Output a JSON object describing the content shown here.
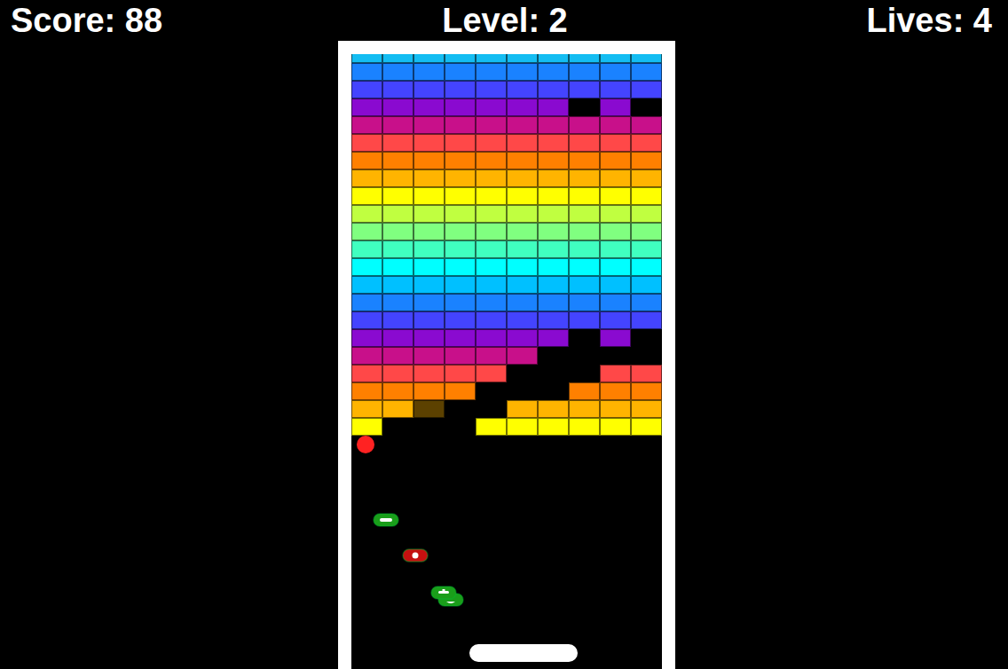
{
  "hud": {
    "score": "Score: 88",
    "level": "Level: 2",
    "lives": "Lives: 4"
  },
  "rows": [
    {
      "color": "#14bdf2",
      "present": [
        true,
        true,
        true,
        true,
        true,
        true,
        true,
        true,
        true,
        true
      ],
      "damaged": [
        false,
        false,
        false,
        false,
        false,
        false,
        false,
        false,
        false,
        false
      ]
    },
    {
      "color": "#1a82ff",
      "present": [
        true,
        true,
        true,
        true,
        true,
        true,
        true,
        true,
        true,
        true
      ],
      "damaged": [
        false,
        false,
        false,
        false,
        false,
        false,
        false,
        false,
        false,
        false
      ]
    },
    {
      "color": "#4444ff",
      "present": [
        true,
        true,
        true,
        true,
        true,
        true,
        true,
        true,
        true,
        true
      ],
      "damaged": [
        false,
        false,
        false,
        false,
        false,
        false,
        false,
        false,
        false,
        false
      ]
    },
    {
      "color": "#8a0ad0",
      "present": [
        true,
        true,
        true,
        true,
        true,
        true,
        true,
        false,
        true,
        false
      ],
      "damaged": [
        false,
        false,
        false,
        false,
        false,
        false,
        false,
        false,
        false,
        false
      ]
    },
    {
      "color": "#c8108a",
      "present": [
        true,
        true,
        true,
        true,
        true,
        true,
        true,
        true,
        true,
        true
      ],
      "damaged": [
        false,
        false,
        false,
        false,
        false,
        false,
        false,
        false,
        false,
        false
      ]
    },
    {
      "color": "#ff4848",
      "present": [
        true,
        true,
        true,
        true,
        true,
        true,
        true,
        true,
        true,
        true
      ],
      "damaged": [
        false,
        false,
        false,
        false,
        false,
        false,
        false,
        false,
        false,
        false
      ]
    },
    {
      "color": "#ff8000",
      "present": [
        true,
        true,
        true,
        true,
        true,
        true,
        true,
        true,
        true,
        true
      ],
      "damaged": [
        false,
        false,
        false,
        false,
        false,
        false,
        false,
        false,
        false,
        false
      ]
    },
    {
      "color": "#ffb400",
      "present": [
        true,
        true,
        true,
        true,
        true,
        true,
        true,
        true,
        true,
        true
      ],
      "damaged": [
        false,
        false,
        false,
        false,
        false,
        false,
        false,
        false,
        false,
        false
      ]
    },
    {
      "color": "#ffff00",
      "present": [
        true,
        true,
        true,
        true,
        true,
        true,
        true,
        true,
        true,
        true
      ],
      "damaged": [
        false,
        false,
        false,
        false,
        false,
        false,
        false,
        false,
        false,
        false
      ]
    },
    {
      "color": "#c0ff40",
      "present": [
        true,
        true,
        true,
        true,
        true,
        true,
        true,
        true,
        true,
        true
      ],
      "damaged": [
        false,
        false,
        false,
        false,
        false,
        false,
        false,
        false,
        false,
        false
      ]
    },
    {
      "color": "#80ff80",
      "present": [
        true,
        true,
        true,
        true,
        true,
        true,
        true,
        true,
        true,
        true
      ],
      "damaged": [
        false,
        false,
        false,
        false,
        false,
        false,
        false,
        false,
        false,
        false
      ]
    },
    {
      "color": "#40ffc0",
      "present": [
        true,
        true,
        true,
        true,
        true,
        true,
        true,
        true,
        true,
        true
      ],
      "damaged": [
        false,
        false,
        false,
        false,
        false,
        false,
        false,
        false,
        false,
        false
      ]
    },
    {
      "color": "#00ffff",
      "present": [
        true,
        true,
        true,
        true,
        true,
        true,
        true,
        true,
        true,
        true
      ],
      "damaged": [
        false,
        false,
        false,
        false,
        false,
        false,
        false,
        false,
        false,
        false
      ]
    },
    {
      "color": "#00c0ff",
      "present": [
        true,
        true,
        true,
        true,
        true,
        true,
        true,
        true,
        true,
        true
      ],
      "damaged": [
        false,
        false,
        false,
        false,
        false,
        false,
        false,
        false,
        false,
        false
      ]
    },
    {
      "color": "#1a82ff",
      "present": [
        true,
        true,
        true,
        true,
        true,
        true,
        true,
        true,
        true,
        true
      ],
      "damaged": [
        false,
        false,
        false,
        false,
        false,
        false,
        false,
        false,
        false,
        false
      ]
    },
    {
      "color": "#4444ff",
      "present": [
        true,
        true,
        true,
        true,
        true,
        true,
        true,
        true,
        true,
        true
      ],
      "damaged": [
        false,
        false,
        false,
        false,
        false,
        false,
        false,
        false,
        false,
        false
      ]
    },
    {
      "color": "#8a0ad0",
      "present": [
        true,
        true,
        true,
        true,
        true,
        true,
        true,
        false,
        true,
        false
      ],
      "damaged": [
        false,
        false,
        false,
        false,
        false,
        false,
        false,
        false,
        false,
        false
      ]
    },
    {
      "color": "#c8108a",
      "present": [
        true,
        true,
        true,
        true,
        true,
        true,
        false,
        false,
        false,
        false
      ],
      "damaged": [
        false,
        false,
        false,
        false,
        false,
        false,
        false,
        false,
        false,
        false
      ]
    },
    {
      "color": "#ff4848",
      "present": [
        true,
        true,
        true,
        true,
        true,
        false,
        false,
        false,
        true,
        true
      ],
      "damaged": [
        false,
        false,
        false,
        false,
        false,
        false,
        false,
        false,
        false,
        false
      ]
    },
    {
      "color": "#ff8000",
      "present": [
        true,
        true,
        true,
        true,
        false,
        false,
        false,
        true,
        true,
        true
      ],
      "damaged": [
        false,
        false,
        false,
        false,
        false,
        false,
        false,
        false,
        false,
        false
      ]
    },
    {
      "color": "#ffb400",
      "present": [
        true,
        true,
        true,
        false,
        false,
        true,
        true,
        true,
        true,
        true
      ],
      "damaged": [
        false,
        false,
        true,
        false,
        false,
        false,
        false,
        false,
        false,
        false
      ]
    },
    {
      "color": "#ffff00",
      "present": [
        true,
        false,
        false,
        false,
        true,
        true,
        true,
        true,
        true,
        true
      ],
      "damaged": [
        false,
        false,
        false,
        false,
        false,
        false,
        false,
        false,
        false,
        false
      ]
    }
  ],
  "powerups": [
    {
      "color": "#1a9e1a"
    },
    {
      "color": "#c41010"
    },
    {
      "color": "#1a9e1a"
    },
    {
      "color": "#1a9e1a"
    }
  ]
}
